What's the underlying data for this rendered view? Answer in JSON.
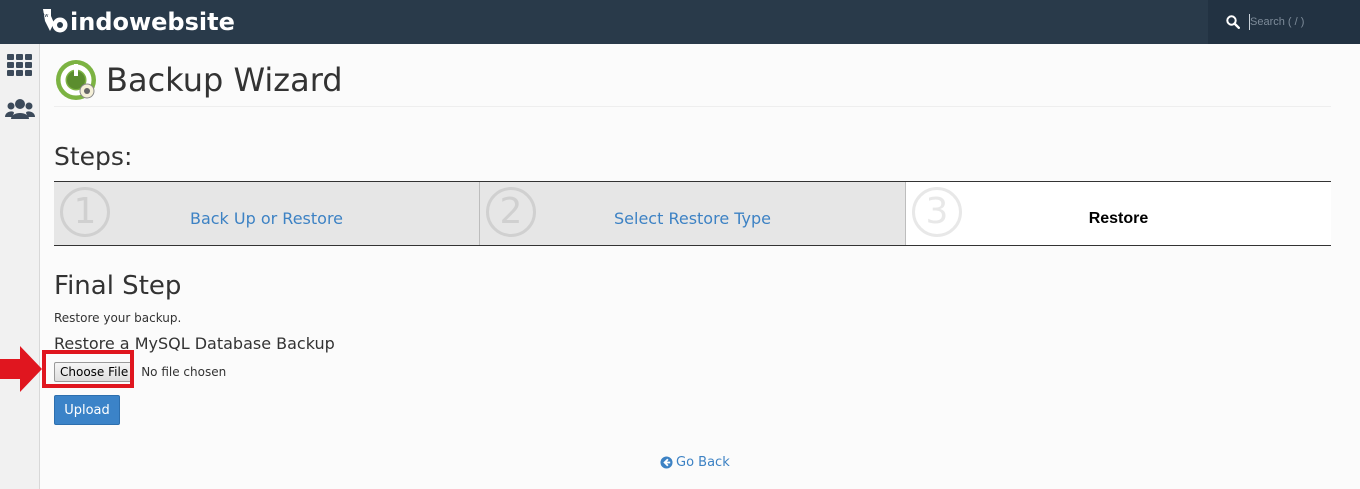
{
  "brand": {
    "name": "indowebsite"
  },
  "search": {
    "placeholder": "Search ( / )"
  },
  "sidebar": {
    "items": [
      {
        "icon": "apps-grid-icon"
      },
      {
        "icon": "users-icon"
      }
    ]
  },
  "page": {
    "title": "Backup Wizard"
  },
  "steps": {
    "heading": "Steps:",
    "items": [
      {
        "number": "1",
        "label": "Back Up or Restore",
        "active": false
      },
      {
        "number": "2",
        "label": "Select Restore Type",
        "active": false
      },
      {
        "number": "3",
        "label": "Restore",
        "active": true
      }
    ]
  },
  "final": {
    "heading": "Final Step",
    "description": "Restore your backup.",
    "section_heading": "Restore a MySQL Database Backup",
    "choose_file_label": "Choose File",
    "no_file_text": "No file chosen",
    "upload_label": "Upload"
  },
  "go_back": {
    "label": "Go Back"
  },
  "colors": {
    "topbar": "#293a4a",
    "link": "#3d82c4",
    "primary_button": "#3b83c8",
    "highlight": "#e0161f"
  }
}
